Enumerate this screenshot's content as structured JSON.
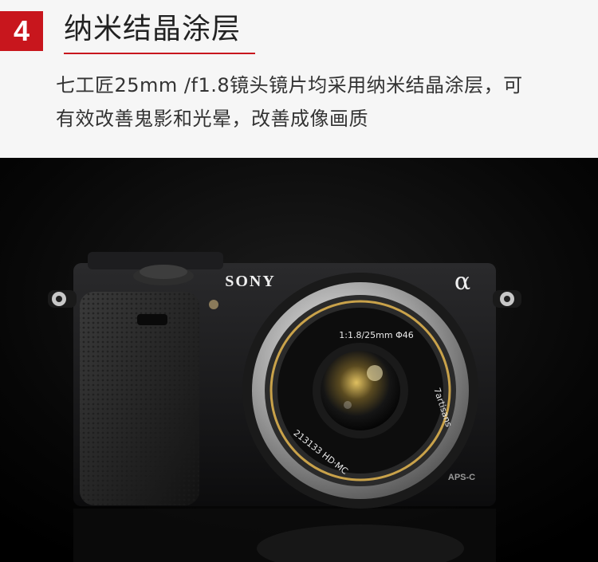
{
  "section": {
    "number": "4",
    "title": "纳米结晶涂层",
    "description_line1": "七工匠25mm /f1.8镜头镜片均采用纳米结晶涂层，可",
    "description_line2": "有效改善鬼影和光晕，改善成像画质"
  },
  "photo": {
    "brand": "SONY",
    "alpha": "α",
    "lens_spec": "1:1.8/25mm  Φ46",
    "lens_brand": "7artisans",
    "lens_serial": "213133  HD·MC",
    "sensor_label": "APS-C"
  },
  "colors": {
    "accent": "#c8161d",
    "text": "#333333",
    "background": "#f6f6f6"
  }
}
